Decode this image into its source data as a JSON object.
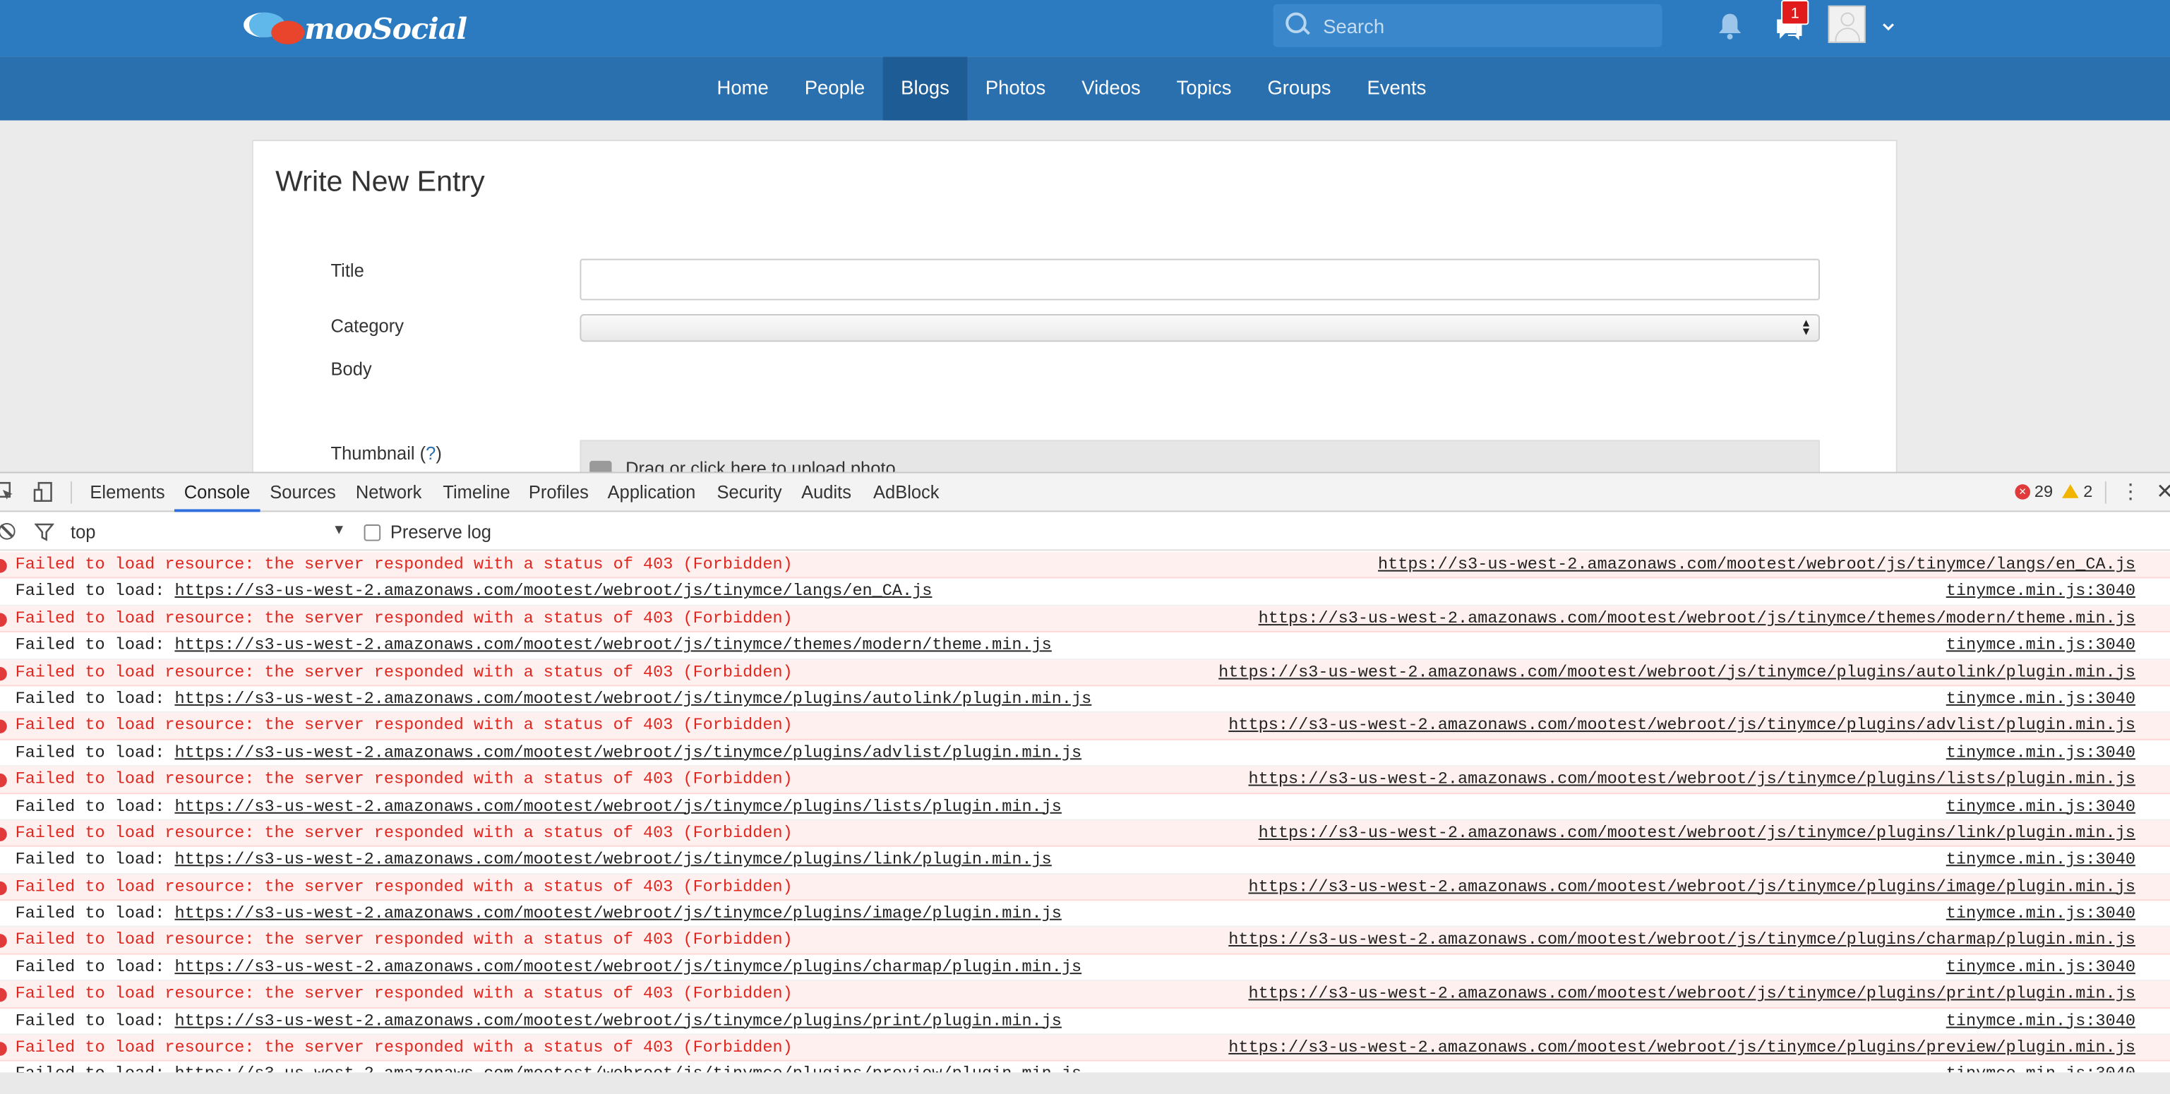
{
  "brand": {
    "logo_text": "mooSocial"
  },
  "header": {
    "search_placeholder": "Search",
    "message_count": "1"
  },
  "nav": {
    "items": [
      {
        "label": "Home"
      },
      {
        "label": "People"
      },
      {
        "label": "Blogs"
      },
      {
        "label": "Photos"
      },
      {
        "label": "Videos"
      },
      {
        "label": "Topics"
      },
      {
        "label": "Groups"
      },
      {
        "label": "Events"
      }
    ],
    "active": "Blogs"
  },
  "form": {
    "title": "Write New Entry",
    "title_label": "Title",
    "category_label": "Category",
    "body_label": "Body",
    "thumbnail_label": "Thumbnail",
    "thumbnail_help": "?",
    "upload_text": "Drag or click here to upload photo"
  },
  "devtools": {
    "tabs": [
      "Elements",
      "Console",
      "Sources",
      "Network",
      "Timeline",
      "Profiles",
      "Application",
      "Security",
      "Audits",
      "AdBlock"
    ],
    "active_tab": "Console",
    "error_count": "29",
    "warning_count": "2",
    "context": "top",
    "preserve_log_label": "Preserve log"
  },
  "console": {
    "error_message": "Failed to load resource: the server responded with a status of 403 (Forbidden)",
    "info_prefix": "Failed to load: ",
    "source": "tinymce.min.js:3040",
    "urls": [
      "https://s3-us-west-2.amazonaws.com/mootest/webroot/js/tinymce/langs/en_CA.js",
      "https://s3-us-west-2.amazonaws.com/mootest/webroot/js/tinymce/themes/modern/theme.min.js",
      "https://s3-us-west-2.amazonaws.com/mootest/webroot/js/tinymce/plugins/autolink/plugin.min.js",
      "https://s3-us-west-2.amazonaws.com/mootest/webroot/js/tinymce/plugins/advlist/plugin.min.js",
      "https://s3-us-west-2.amazonaws.com/mootest/webroot/js/tinymce/plugins/lists/plugin.min.js",
      "https://s3-us-west-2.amazonaws.com/mootest/webroot/js/tinymce/plugins/link/plugin.min.js",
      "https://s3-us-west-2.amazonaws.com/mootest/webroot/js/tinymce/plugins/image/plugin.min.js",
      "https://s3-us-west-2.amazonaws.com/mootest/webroot/js/tinymce/plugins/charmap/plugin.min.js",
      "https://s3-us-west-2.amazonaws.com/mootest/webroot/js/tinymce/plugins/print/plugin.min.js",
      "https://s3-us-west-2.amazonaws.com/mootest/webroot/js/tinymce/plugins/preview/plugin.min.js"
    ]
  },
  "colors": {
    "topbar": "#2c7bc0",
    "navbar": "#2a6fae",
    "error_text": "#e0271f",
    "error_bg": "#fff0f0"
  }
}
